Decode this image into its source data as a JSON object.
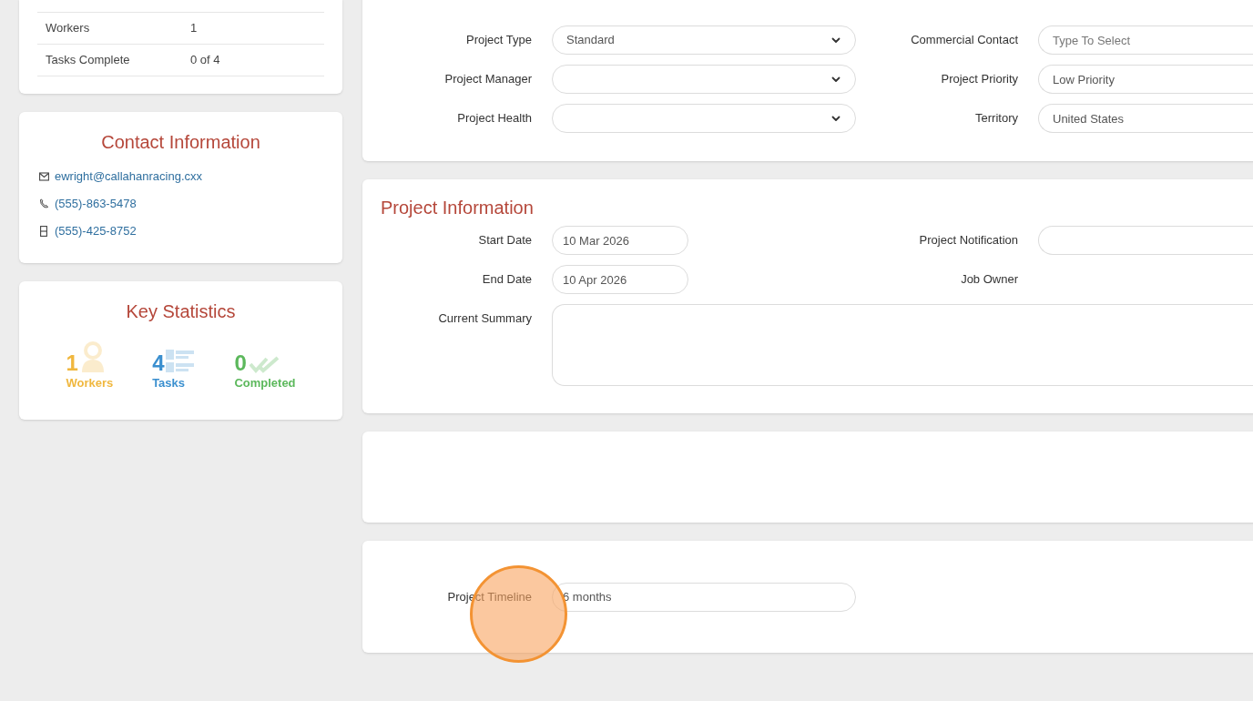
{
  "summary_table": {
    "rows": [
      {
        "label": "Workers",
        "value": "1"
      },
      {
        "label": "Tasks Complete",
        "value": "0 of 4"
      }
    ]
  },
  "contact": {
    "title": "Contact Information",
    "items": [
      {
        "kind": "email",
        "text": "ewright@callahanracing.cxx"
      },
      {
        "kind": "phone",
        "text": "(555)-863-5478"
      },
      {
        "kind": "mobile",
        "text": "(555)-425-8752"
      }
    ]
  },
  "key_statistics": {
    "title": "Key Statistics",
    "items": [
      {
        "kind": "workers",
        "value": "1",
        "label": "Workers",
        "color": "#f0b73e"
      },
      {
        "kind": "tasks",
        "value": "4",
        "label": "Tasks",
        "color": "#3a8fcf"
      },
      {
        "kind": "completed",
        "value": "0",
        "label": "Completed",
        "color": "#5cb85c"
      }
    ]
  },
  "project_details": {
    "rows": [
      [
        {
          "label": "Project Type",
          "kind": "select",
          "value": "Standard"
        },
        {
          "label": "Commercial Contact",
          "kind": "input",
          "placeholder": "Type To Select"
        }
      ],
      [
        {
          "label": "Project Manager",
          "kind": "select"
        },
        {
          "label": "Project Priority",
          "kind": "input",
          "value": "Low Priority"
        }
      ],
      [
        {
          "label": "Project Health",
          "kind": "select"
        },
        {
          "label": "Territory",
          "kind": "input",
          "value": "United States"
        }
      ]
    ]
  },
  "project_information": {
    "title": "Project Information",
    "rows": [
      [
        {
          "label": "Start Date",
          "kind": "date",
          "value": "10 Mar 2026"
        },
        {
          "label": "Project Notification",
          "kind": "input"
        }
      ],
      [
        {
          "label": "End Date",
          "kind": "date",
          "value": "10 Apr 2026"
        },
        {
          "label": "Job Owner",
          "kind": "label_only"
        }
      ]
    ],
    "summary": {
      "label": "Current Summary"
    }
  },
  "timeline": {
    "label": "Project Timeline",
    "value": "6 months"
  },
  "click_marker": {
    "shown": true
  }
}
